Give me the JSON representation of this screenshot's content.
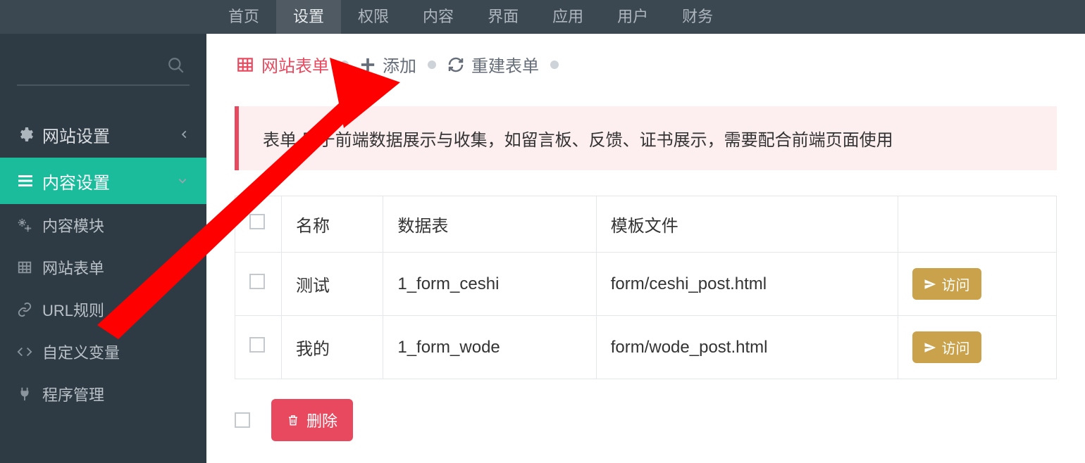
{
  "topnav": {
    "items": [
      "首页",
      "设置",
      "权限",
      "内容",
      "界面",
      "应用",
      "用户",
      "财务"
    ],
    "activeIndex": 1
  },
  "sidebar": {
    "search_placeholder": "",
    "groups": [
      {
        "icon": "gear",
        "label": "网站设置",
        "expand": "right"
      },
      {
        "icon": "bars",
        "label": "内容设置",
        "expand": "down",
        "active": true
      }
    ],
    "sub": [
      {
        "icon": "gears",
        "label": "内容模块"
      },
      {
        "icon": "table",
        "label": "网站表单"
      },
      {
        "icon": "link",
        "label": "URL规则"
      },
      {
        "icon": "code",
        "label": "自定义变量"
      },
      {
        "icon": "plug",
        "label": "程序管理"
      }
    ]
  },
  "toolbar": {
    "tabs": [
      {
        "icon": "table",
        "label": "网站表单",
        "active": true
      },
      {
        "icon": "plus",
        "label": "添加"
      },
      {
        "icon": "refresh",
        "label": "重建表单"
      }
    ]
  },
  "info_text": "表单       用于前端数据展示与收集，如留言板、反馈、证书展示，需要配合前端页面使用",
  "table": {
    "headers": [
      "",
      "名称",
      "数据表",
      "模板文件",
      ""
    ],
    "rows": [
      {
        "name": "测试",
        "db": "1_form_ceshi",
        "tpl": "form/ceshi_post.html",
        "visit": "访问"
      },
      {
        "name": "我的",
        "db": "1_form_wode",
        "tpl": "form/wode_post.html",
        "visit": "访问"
      }
    ]
  },
  "buttons": {
    "visit_label": "访问",
    "delete_label": "删除"
  },
  "colors": {
    "accent_teal": "#1abc9c",
    "accent_red": "#e9495f",
    "accent_gold": "#c9a24b",
    "nav_bg": "#3b4751",
    "sidebar_bg": "#2f3b44"
  }
}
